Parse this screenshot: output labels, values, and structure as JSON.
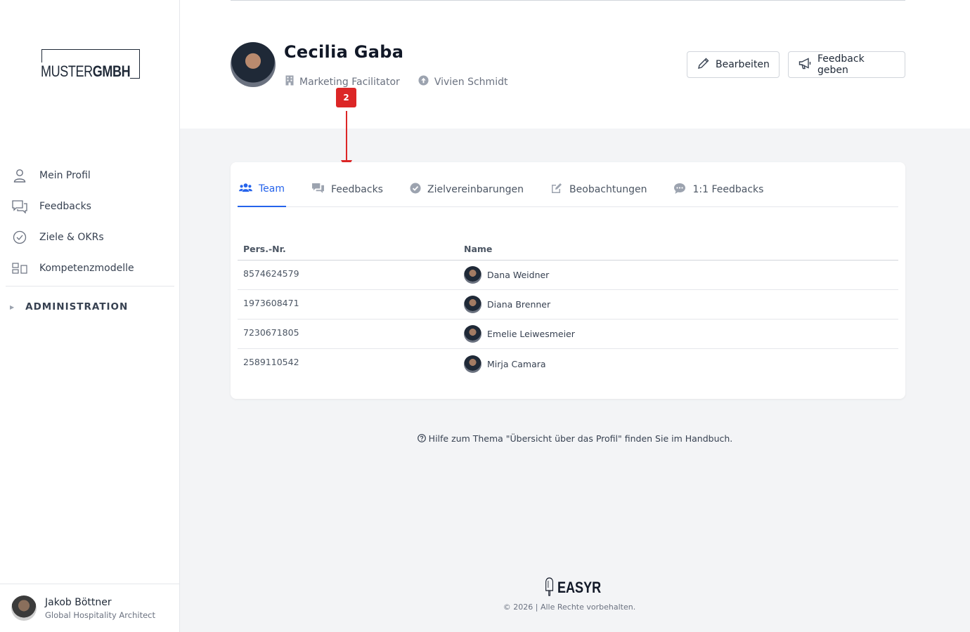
{
  "sidebar": {
    "logo_light": "MUSTER",
    "logo_bold": "GMBH",
    "items": [
      {
        "label": "Mein Profil",
        "icon": "user-icon"
      },
      {
        "label": "Feedbacks",
        "icon": "chat-icon"
      },
      {
        "label": "Ziele & OKRs",
        "icon": "check-circle-icon"
      },
      {
        "label": "Kompetenzmodelle",
        "icon": "blocks-icon"
      }
    ],
    "admin_label": "ADMINISTRATION",
    "user": {
      "name": "Jakob Böttner",
      "role": "Global Hospitality Architect"
    }
  },
  "profile": {
    "name": "Cecilia Gaba",
    "position": "Marketing Facilitator",
    "manager": "Vivien Schmidt",
    "edit_label": "Bearbeiten",
    "feedback_label": "Feedback geben"
  },
  "annotation": {
    "number": "2"
  },
  "tabs": [
    {
      "label": "Team",
      "active": true
    },
    {
      "label": "Feedbacks",
      "active": false
    },
    {
      "label": "Zielvereinbarungen",
      "active": false
    },
    {
      "label": "Beobachtungen",
      "active": false
    },
    {
      "label": "1:1 Feedbacks",
      "active": false
    }
  ],
  "table": {
    "headers": [
      "Pers.-Nr.",
      "Name"
    ],
    "rows": [
      {
        "id": "8574624579",
        "name": "Dana Weidner"
      },
      {
        "id": "1973608471",
        "name": "Diana Brenner"
      },
      {
        "id": "7230671805",
        "name": "Emelie Leiwesmeier"
      },
      {
        "id": "2589110542",
        "name": "Mirja Camara"
      }
    ]
  },
  "footer": {
    "help": "Hilfe zum Thema \"Übersicht über das Profil\" finden Sie im Handbuch.",
    "brand": "EASYR",
    "copyright": "© 2026 | Alle Rechte vorbehalten."
  },
  "colors": {
    "accent": "#2563eb",
    "marker": "#dc2626"
  }
}
